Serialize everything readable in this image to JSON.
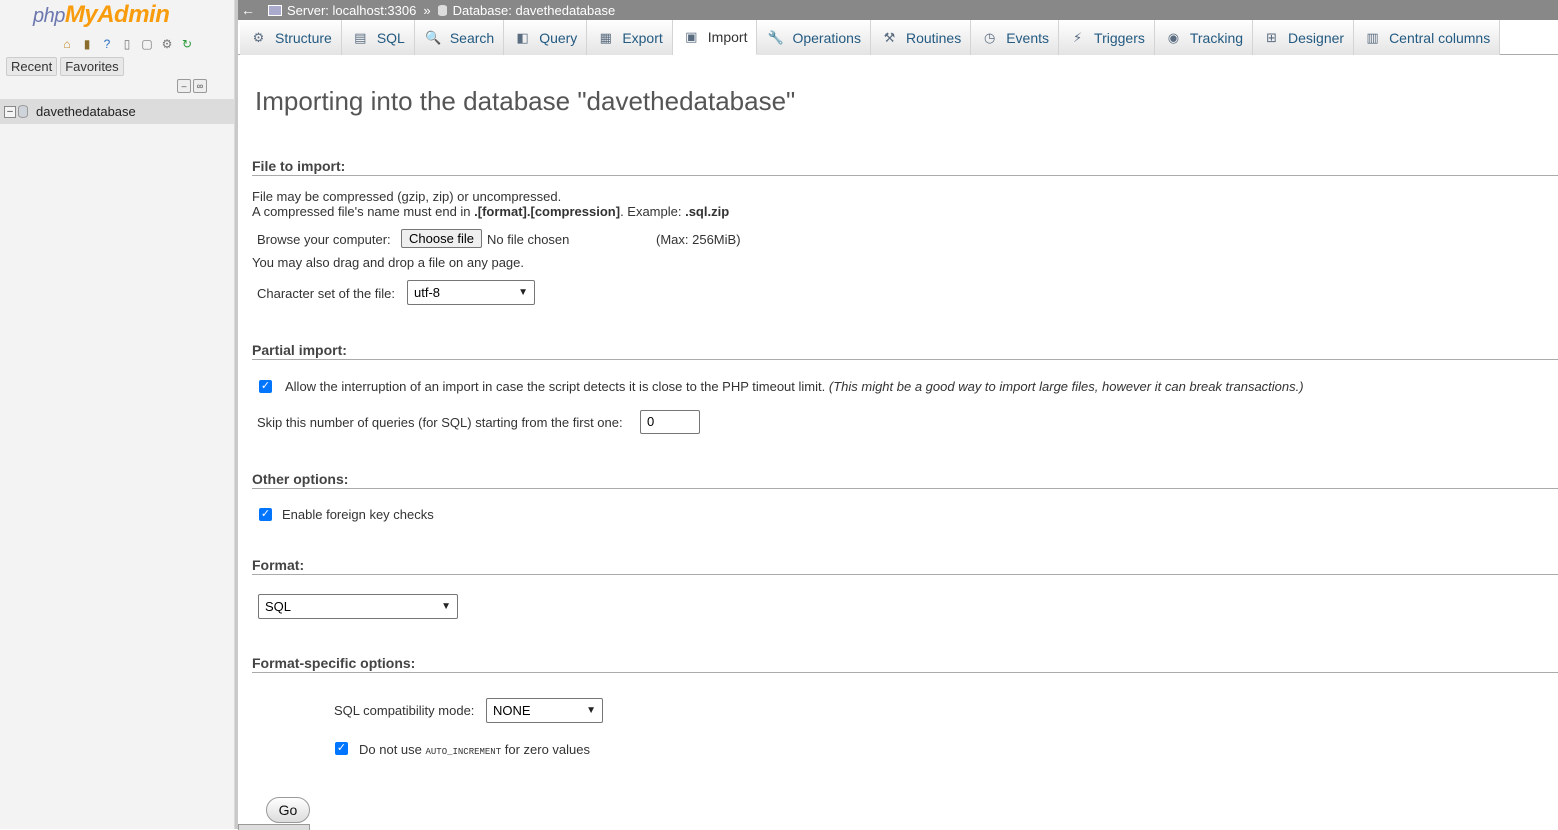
{
  "sidebar": {
    "logo_a": "php",
    "logo_b": "MyAdmin",
    "quick_icons": [
      "home-icon",
      "logout-icon",
      "help-icon",
      "docs-icon",
      "copy-icon",
      "settings-icon",
      "reload-icon"
    ],
    "recent_label": "Recent",
    "favorites_label": "Favorites",
    "collapse_all_symbol": "–",
    "link_symbol": "∞",
    "databases": [
      {
        "name": "davethedatabase",
        "expander": "–"
      }
    ]
  },
  "topbar": {
    "back_symbol": "←",
    "server_label": "Server: localhost:3306",
    "separator": "»",
    "database_label": "Database: davethedatabase"
  },
  "tabs": [
    {
      "label": "Structure",
      "icon": "structure-icon",
      "glyph": "⚙"
    },
    {
      "label": "SQL",
      "icon": "sql-icon",
      "glyph": "▤"
    },
    {
      "label": "Search",
      "icon": "search-icon",
      "glyph": "🔍"
    },
    {
      "label": "Query",
      "icon": "query-icon",
      "glyph": "◧"
    },
    {
      "label": "Export",
      "icon": "export-icon",
      "glyph": "▦"
    },
    {
      "label": "Import",
      "icon": "import-icon",
      "glyph": "▣",
      "active": true
    },
    {
      "label": "Operations",
      "icon": "operations-icon",
      "glyph": "🔧"
    },
    {
      "label": "Routines",
      "icon": "routines-icon",
      "glyph": "⚒"
    },
    {
      "label": "Events",
      "icon": "events-icon",
      "glyph": "◷"
    },
    {
      "label": "Triggers",
      "icon": "triggers-icon",
      "glyph": "⚡"
    },
    {
      "label": "Tracking",
      "icon": "tracking-icon",
      "glyph": "◉"
    },
    {
      "label": "Designer",
      "icon": "designer-icon",
      "glyph": "⊞"
    },
    {
      "label": "Central columns",
      "icon": "central-columns-icon",
      "glyph": "▥"
    }
  ],
  "main": {
    "title": "Importing into the database \"davethedatabase\"",
    "file_section": {
      "heading": "File to import:",
      "line1": "File may be compressed (gzip, zip) or uncompressed.",
      "line2_prefix": "A compressed file's name must end in ",
      "line2_pattern": ".[format].[compression]",
      "line2_mid": ". Example: ",
      "line2_example": ".sql.zip",
      "browse_label": "Browse your computer:",
      "choose_button": "Choose file",
      "no_file": "No file chosen",
      "max_size": "(Max: 256MiB)",
      "drag_note": "You may also drag and drop a file on any page.",
      "charset_label": "Character set of the file:",
      "charset_value": "utf-8"
    },
    "partial_section": {
      "heading": "Partial import:",
      "allow_interrupt_label": "Allow the interruption of an import in case the script detects it is close to the PHP timeout limit.",
      "allow_interrupt_note": "(This might be a good way to import large files, however it can break transactions.)",
      "allow_interrupt_checked": true,
      "skip_label": "Skip this number of queries (for SQL) starting from the first one:",
      "skip_value": "0"
    },
    "other_section": {
      "heading": "Other options:",
      "fk_label": "Enable foreign key checks",
      "fk_checked": true
    },
    "format_section": {
      "heading": "Format:",
      "format_value": "SQL"
    },
    "format_specific_section": {
      "heading": "Format-specific options:",
      "compat_label": "SQL compatibility mode:",
      "compat_value": "NONE",
      "auto_inc_prefix": "Do not use ",
      "auto_inc_code": "AUTO_INCREMENT",
      "auto_inc_suffix": " for zero values",
      "auto_inc_checked": true
    },
    "go_button": "Go"
  },
  "colors": {
    "tab_text": "#235a81",
    "topbar_bg": "#888888",
    "checkbox": "#0075ff",
    "logo_blue": "#6c78af",
    "logo_orange": "#f89c0e"
  }
}
